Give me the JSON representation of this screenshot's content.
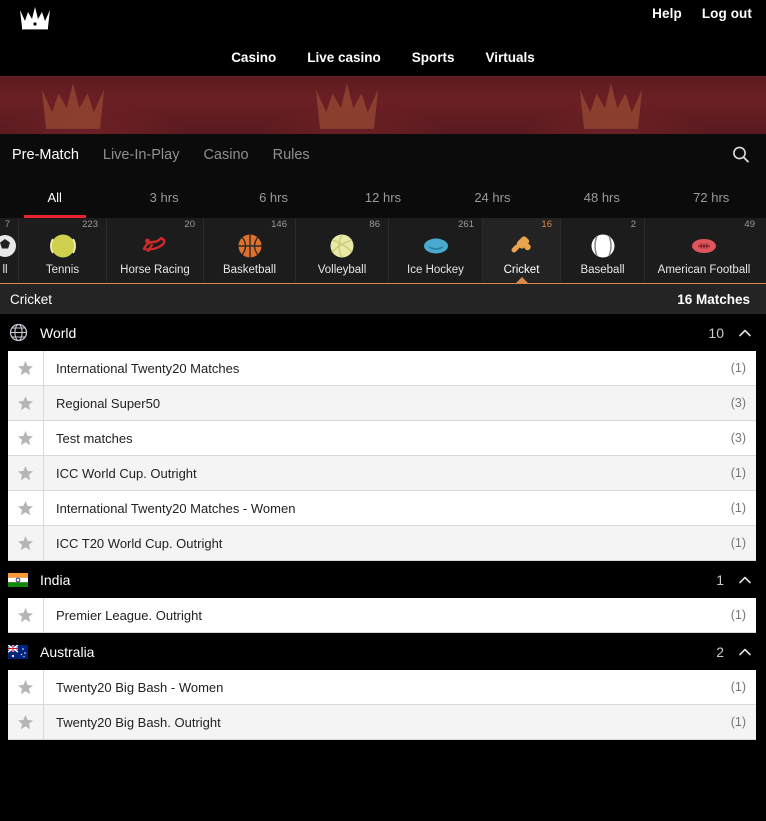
{
  "header": {
    "logo_icon": "crown-logo",
    "links": [
      {
        "label": "Help"
      },
      {
        "label": "Log out"
      }
    ],
    "nav": [
      {
        "label": "Casino"
      },
      {
        "label": "Live casino"
      },
      {
        "label": "Sports"
      },
      {
        "label": "Virtuals"
      }
    ]
  },
  "subtabs": {
    "items": [
      {
        "label": "Pre-Match",
        "active": true
      },
      {
        "label": "Live-In-Play",
        "active": false
      },
      {
        "label": "Casino",
        "active": false
      },
      {
        "label": "Rules",
        "active": false
      }
    ],
    "search_icon": "search-icon"
  },
  "hour_filters": {
    "items": [
      {
        "label": "All",
        "active": true
      },
      {
        "label": "3 hrs",
        "active": false
      },
      {
        "label": "6 hrs",
        "active": false
      },
      {
        "label": "12 hrs",
        "active": false
      },
      {
        "label": "24 hrs",
        "active": false
      },
      {
        "label": "48 hrs",
        "active": false
      },
      {
        "label": "72 hrs",
        "active": false
      }
    ],
    "active_underline_color": "#e8222e"
  },
  "sports": {
    "accent_color": "#d98a4a",
    "items": [
      {
        "name": "ll",
        "count": "7",
        "icon": "football-icon",
        "active": false
      },
      {
        "name": "Tennis",
        "count": "223",
        "icon": "tennis-ball-icon",
        "active": false
      },
      {
        "name": "Horse Racing",
        "count": "20",
        "icon": "horse-racing-icon",
        "active": false
      },
      {
        "name": "Basketball",
        "count": "146",
        "icon": "basketball-icon",
        "active": false
      },
      {
        "name": "Volleyball",
        "count": "86",
        "icon": "volleyball-icon",
        "active": false
      },
      {
        "name": "Ice Hockey",
        "count": "261",
        "icon": "ice-hockey-puck-icon",
        "active": false
      },
      {
        "name": "Cricket",
        "count": "16",
        "icon": "cricket-bat-icon",
        "active": true
      },
      {
        "name": "Baseball",
        "count": "2",
        "icon": "baseball-icon",
        "active": false
      },
      {
        "name": "American Football",
        "count": "49",
        "icon": "american-football-icon",
        "active": false
      }
    ]
  },
  "sport_title": {
    "name": "Cricket",
    "matches": "16 Matches"
  },
  "regions": [
    {
      "name": "World",
      "count": "10",
      "flag": "globe-icon",
      "expanded": true,
      "leagues": [
        {
          "name": "International Twenty20 Matches",
          "count": "(1)"
        },
        {
          "name": "Regional Super50",
          "count": "(3)"
        },
        {
          "name": "Test matches",
          "count": "(3)"
        },
        {
          "name": "ICC World Cup. Outright",
          "count": "(1)"
        },
        {
          "name": "International Twenty20 Matches - Women",
          "count": "(1)"
        },
        {
          "name": "ICC T20 World Cup. Outright",
          "count": "(1)"
        }
      ]
    },
    {
      "name": "India",
      "count": "1",
      "flag": "india-flag-icon",
      "expanded": true,
      "leagues": [
        {
          "name": "Premier League. Outright",
          "count": "(1)"
        }
      ]
    },
    {
      "name": "Australia",
      "count": "2",
      "flag": "australia-flag-icon",
      "expanded": true,
      "leagues": [
        {
          "name": "Twenty20 Big Bash - Women",
          "count": "(1)"
        },
        {
          "name": "Twenty20 Big Bash. Outright",
          "count": "(1)"
        }
      ]
    }
  ]
}
